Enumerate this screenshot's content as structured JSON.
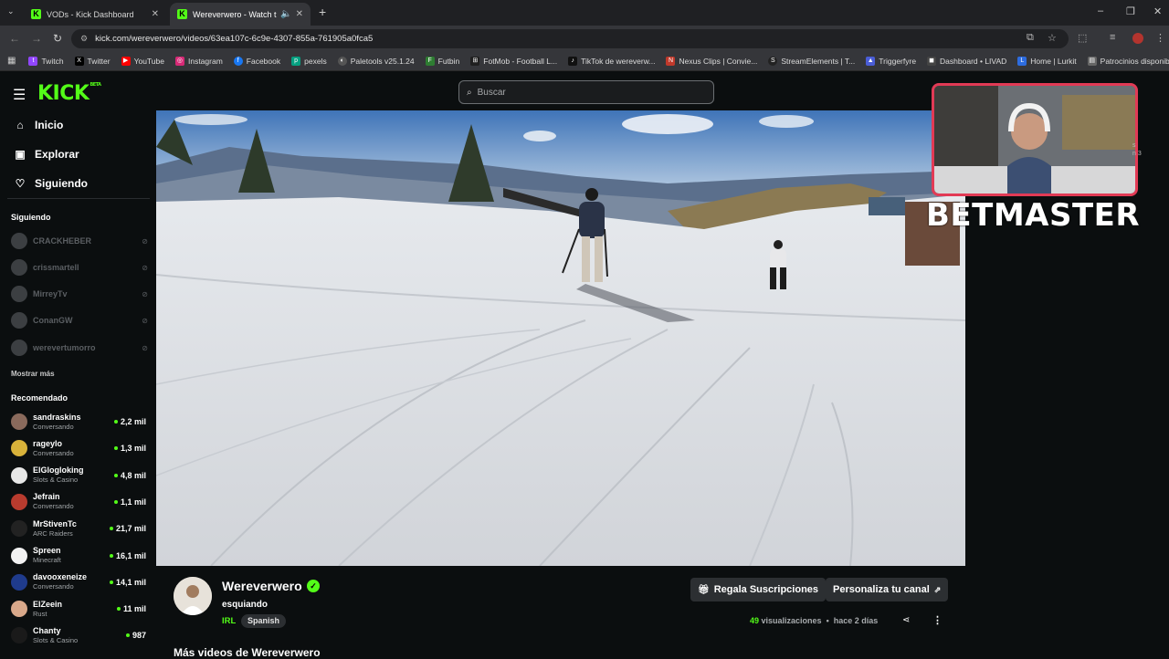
{
  "browser": {
    "tabs": [
      {
        "title": "VODs - Kick Dashboard",
        "active": false
      },
      {
        "title": "Wereverwero - Watch the V",
        "active": true
      }
    ],
    "new_tab": "+",
    "url": "kick.com/wereverwero/videos/63ea107c-6c9e-4307-855a-761905a0fca5",
    "bookmarks": [
      {
        "label": "Twitch",
        "icon": "twitch-icon",
        "color": "#9146ff"
      },
      {
        "label": "Twitter",
        "icon": "x-icon",
        "color": "#000000"
      },
      {
        "label": "YouTube",
        "icon": "youtube-icon",
        "color": "#ff0000"
      },
      {
        "label": "Instagram",
        "icon": "instagram-icon",
        "color": "#d62976"
      },
      {
        "label": "Facebook",
        "icon": "facebook-icon",
        "color": "#1877f2"
      },
      {
        "label": "pexels",
        "icon": "pexels-icon",
        "color": "#05a081"
      },
      {
        "label": "Paletools v25.1.24",
        "icon": "paletools-icon",
        "color": "#555555"
      },
      {
        "label": "Futbin",
        "icon": "futbin-icon",
        "color": "#2e7d32"
      },
      {
        "label": "FotMob - Football L...",
        "icon": "fotmob-icon",
        "color": "#1f1f1f"
      },
      {
        "label": "TikTok de wereverw...",
        "icon": "tiktok-icon",
        "color": "#111111"
      },
      {
        "label": "Nexus Clips | Convie...",
        "icon": "nexus-icon",
        "color": "#c0392b"
      },
      {
        "label": "StreamElements | T...",
        "icon": "streamelements-icon",
        "color": "#222222"
      },
      {
        "label": "Triggerfyre",
        "icon": "triggerfyre-icon",
        "color": "#4a5dd6"
      },
      {
        "label": "Dashboard • LIVAD",
        "icon": "livad-icon",
        "color": "#444444"
      },
      {
        "label": "Home | Lurkit",
        "icon": "lurkit-icon",
        "color": "#2d6cdf"
      },
      {
        "label": "Patrocinios disponib...",
        "icon": "folder-icon",
        "color": "#666666"
      }
    ]
  },
  "header": {
    "logo": "KICK",
    "logo_badge": "BETA",
    "search_placeholder": "Buscar"
  },
  "sidebar": {
    "nav": [
      {
        "label": "Inicio",
        "icon": "home-icon"
      },
      {
        "label": "Explorar",
        "icon": "explore-icon"
      },
      {
        "label": "Siguiendo",
        "icon": "heart-icon"
      }
    ],
    "following_title": "Siguiendo",
    "following": [
      {
        "name": "CRACKHEBER"
      },
      {
        "name": "crissmartell"
      },
      {
        "name": "MirreyTv"
      },
      {
        "name": "ConanGW"
      },
      {
        "name": "werevertumorro"
      }
    ],
    "show_more": "Mostrar más",
    "recommended_title": "Recomendado",
    "recommended": [
      {
        "name": "sandraskins",
        "category": "Conversando",
        "viewers": "2,2 mil",
        "color": "#8a6a5c"
      },
      {
        "name": "rageylo",
        "category": "Conversando",
        "viewers": "1,3 mil",
        "color": "#d8b23a"
      },
      {
        "name": "ElGlogloking",
        "category": "Slots & Casino",
        "viewers": "4,8 mil",
        "color": "#e7e7e7"
      },
      {
        "name": "Jefrain",
        "category": "Conversando",
        "viewers": "1,1 mil",
        "color": "#b83b2e"
      },
      {
        "name": "MrStivenTc",
        "category": "ARC Raiders",
        "viewers": "21,7 mil",
        "color": "#222222"
      },
      {
        "name": "Spreen",
        "category": "Minecraft",
        "viewers": "16,1 mil",
        "color": "#f2f2f2"
      },
      {
        "name": "davooxeneize",
        "category": "Conversando",
        "viewers": "14,1 mil",
        "color": "#1f3b8c"
      },
      {
        "name": "ElZeein",
        "category": "Rust",
        "viewers": "11 mil",
        "color": "#d9a88a"
      },
      {
        "name": "Chanty",
        "category": "Slots & Casino",
        "viewers": "987",
        "color": "#1a1a1a"
      }
    ]
  },
  "overlay": {
    "brand": "BETMASTER",
    "side_text_1": "s",
    "side_text_2": "n 3"
  },
  "video_info": {
    "channel": "Wereverwero",
    "title": "esquiando",
    "category": "IRL",
    "language": "Spanish",
    "gift_button": "Regala Suscripciones",
    "customize_button": "Personaliza tu canal",
    "views_count": "49",
    "views_label": "visualizaciones",
    "age": "hace 2 días",
    "more_videos": "Más videos de Wereverwero"
  },
  "colors": {
    "accent": "#53fc18",
    "background": "#0b0e0f",
    "overlay_border": "#e23a55"
  }
}
